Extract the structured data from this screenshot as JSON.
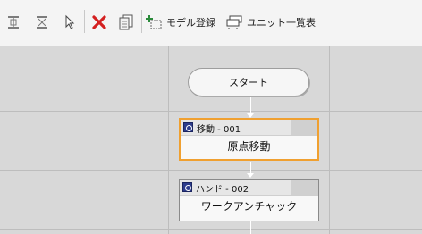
{
  "toolbar": {
    "model_register_label": "モデル登録",
    "unit_list_label": "ユニット一覧表"
  },
  "flow": {
    "start_label": "スタート",
    "blocks": [
      {
        "category": "移動 - 001",
        "name": "原点移動",
        "selected": true
      },
      {
        "category": "ハンド - 002",
        "name": "ワークアンチャック",
        "selected": false
      }
    ]
  },
  "colors": {
    "selection_border": "#f0a030",
    "delete_icon": "#d42020",
    "canvas_bg": "#d8d8d8",
    "block_badge": "#2d3c8c"
  }
}
